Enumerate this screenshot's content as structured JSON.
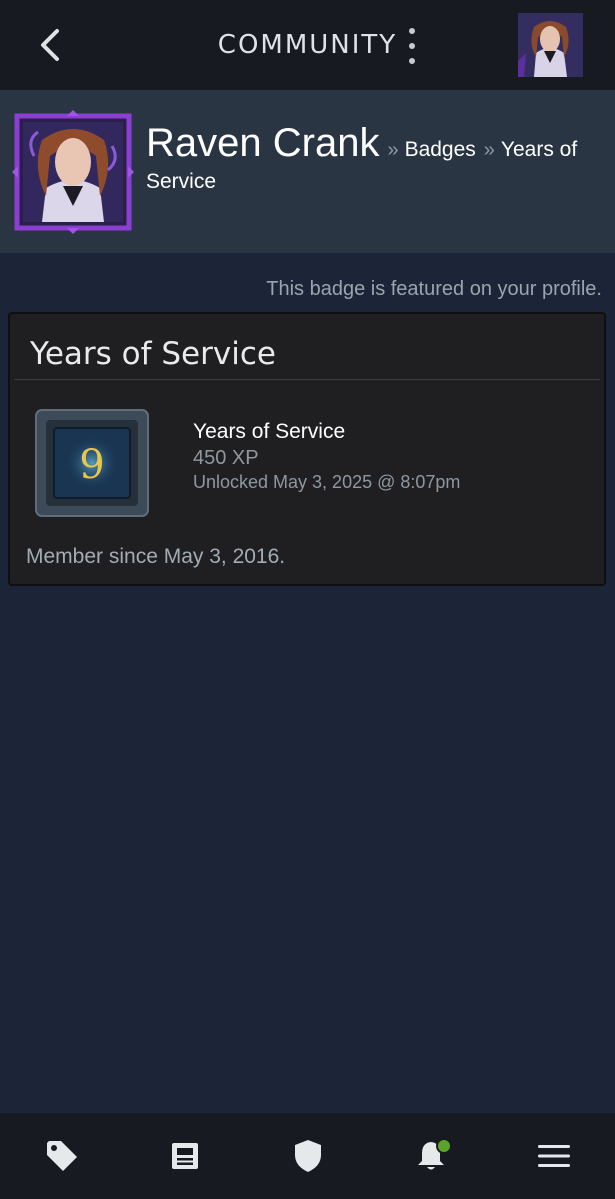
{
  "topbar": {
    "title": "COMMUNITY",
    "back_icon": "chevron-left-icon",
    "menu_icon": "kebab-menu-icon"
  },
  "profile": {
    "name": "Raven Crank",
    "breadcrumb_sep": "»",
    "crumb_badges": "Badges",
    "crumb_current": "Years of Service",
    "avatar_frame_color": "#8a3fd1"
  },
  "featured_note": "This badge is featured on your profile.",
  "badge": {
    "title": "Years of Service",
    "icon_number": "9",
    "name": "Years of Service",
    "xp": "450 XP",
    "unlocked": "Unlocked May 3, 2025 @ 8:07pm",
    "member_since": "Member since May 3, 2016."
  },
  "bottom_nav": {
    "items": [
      "tag-icon",
      "news-icon",
      "shield-icon",
      "bell-icon",
      "hamburger-menu-icon"
    ],
    "notification_color": "#5ba32b"
  },
  "colors": {
    "background": "#1b2537",
    "topbar": "#171a21",
    "header": "#2a3544",
    "card": "#1f1f21"
  }
}
